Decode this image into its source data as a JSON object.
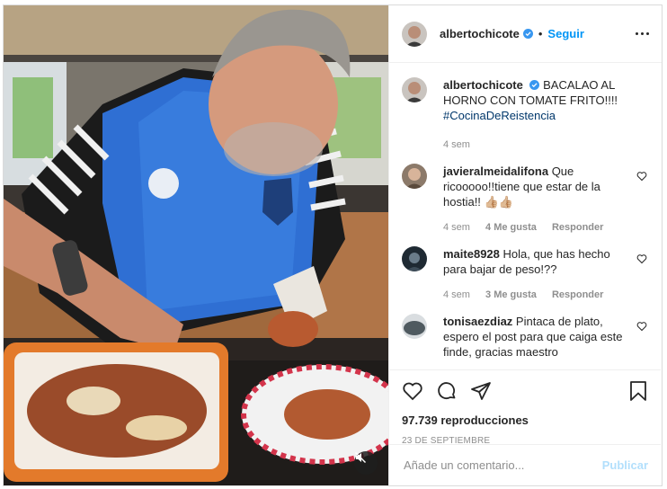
{
  "post": {
    "author": "albertochicote",
    "follow_label": "Seguir",
    "separator": "•",
    "caption_title": "BACALAO AL HORNO CON TOMATE FRITO!!!!",
    "caption_hashtag": "#CocinaDeReistencia",
    "caption_time": "4 sem",
    "views": "97.739 reproducciones",
    "date": "23 DE SEPTIEMBRE"
  },
  "comments": [
    {
      "user": "javieralmeidalifona",
      "text": "Que ricooooo!!tiene que estar de la hostia!! 👍🏼👍🏼",
      "time": "4 sem",
      "likes": "4 Me gusta",
      "reply": "Responder"
    },
    {
      "user": "maite8928",
      "text": "Hola, que has hecho para bajar de peso!??",
      "time": "4 sem",
      "likes": "3 Me gusta",
      "reply": "Responder"
    },
    {
      "user": "tonisaezdiaz",
      "text": "Pintaca de plato, espero el post para que caiga este finde, gracias maestro",
      "time": "",
      "likes": "",
      "reply": ""
    }
  ],
  "composer": {
    "placeholder": "Añade un comentario...",
    "publish_label": "Publicar"
  },
  "icons": {
    "verified": "verified-badge-icon",
    "like": "heart-icon",
    "comment": "comment-bubble-icon",
    "share": "paper-plane-icon",
    "save": "bookmark-icon",
    "mute": "muted-speaker-icon",
    "more": "more-options-icon"
  },
  "colors": {
    "accent": "#0095f6",
    "verified": "#3897f0",
    "publish_disabled": "#b2dffc",
    "muted_text": "#8e8e8e"
  }
}
